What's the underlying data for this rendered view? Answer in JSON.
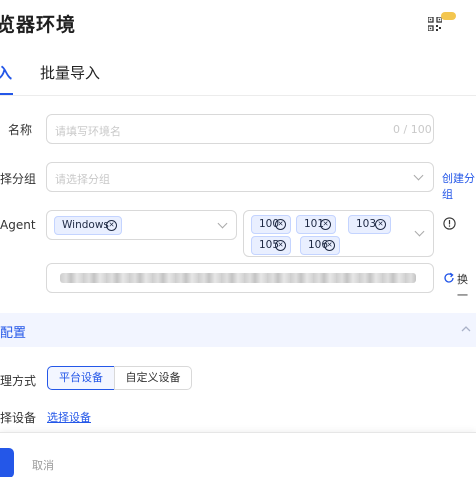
{
  "header": {
    "title": "览器环境",
    "qr_icon": "qr-code-icon",
    "badge_color": "#f3c64f"
  },
  "tabs": [
    {
      "label": "入",
      "active": true
    },
    {
      "label": "批量导入",
      "active": false
    }
  ],
  "accent": "#2457e8",
  "form": {
    "name": {
      "label": "名称",
      "placeholder": "请填写环境名",
      "counter": "0 / 100"
    },
    "group": {
      "label": "择分组",
      "placeholder": "请选择分组",
      "link": "创建分组"
    },
    "agent": {
      "label": "Agent",
      "os_tag": "Windows",
      "version_tags": [
        "100",
        "101",
        "103",
        "105",
        "106"
      ],
      "info_icon": "exclamation-circle-icon"
    },
    "ua": {
      "refresh_label": "换一"
    }
  },
  "section": {
    "title": "配置",
    "collapse_icon": "chevron-up-icon"
  },
  "proxy": {
    "label": "理方式",
    "options": [
      {
        "label": "平台设备",
        "active": true
      },
      {
        "label": "自定义设备",
        "active": false
      }
    ]
  },
  "device": {
    "label": "择设备",
    "link": "选择设备"
  },
  "footer": {
    "cancel": "取消"
  }
}
